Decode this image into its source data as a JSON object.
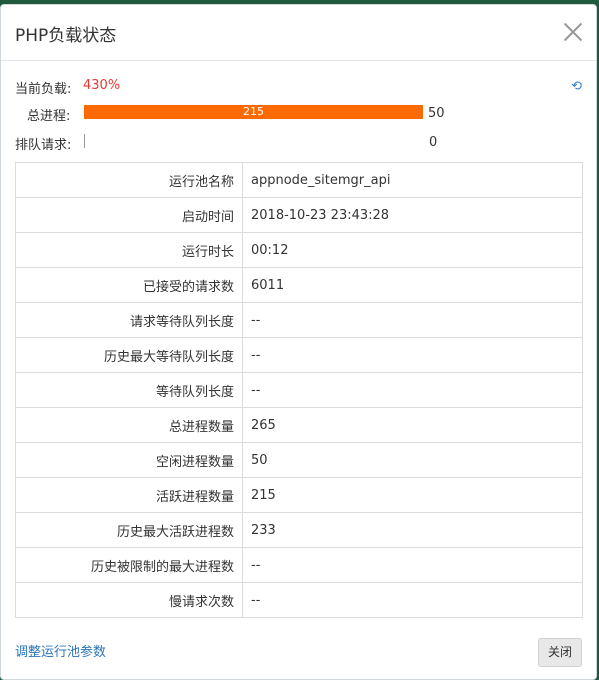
{
  "dialog": {
    "title": "PHP负载状态",
    "close_icon": "close-icon"
  },
  "load": {
    "label": "当前负载:",
    "value": "430%"
  },
  "refresh": {
    "icon": "refresh-icon",
    "glyph": "⟲"
  },
  "total_process": {
    "label": "总进程:",
    "active": "215",
    "idle": "50",
    "active_fraction": 1.0
  },
  "queue": {
    "label": "排队请求:",
    "value": "0"
  },
  "table": {
    "rows": [
      {
        "key": "运行池名称",
        "value": "appnode_sitemgr_api"
      },
      {
        "key": "启动时间",
        "value": "2018-10-23 23:43:28"
      },
      {
        "key": "运行时长",
        "value": "00:12"
      },
      {
        "key": "已接受的请求数",
        "value": "6011"
      },
      {
        "key": "请求等待队列长度",
        "value": "--"
      },
      {
        "key": "历史最大等待队列长度",
        "value": "--"
      },
      {
        "key": "等待队列长度",
        "value": "--"
      },
      {
        "key": "总进程数量",
        "value": "265"
      },
      {
        "key": "空闲进程数量",
        "value": "50"
      },
      {
        "key": "活跃进程数量",
        "value": "215"
      },
      {
        "key": "历史最大活跃进程数",
        "value": "233"
      },
      {
        "key": "历史被限制的最大进程数",
        "value": "--"
      },
      {
        "key": "慢请求次数",
        "value": "--"
      }
    ]
  },
  "footer": {
    "adjust_link": "调整运行池参数",
    "close_button": "关闭"
  },
  "colors": {
    "bar": "#ff6a00",
    "load_value": "#e53935",
    "link": "#2b74b8"
  }
}
